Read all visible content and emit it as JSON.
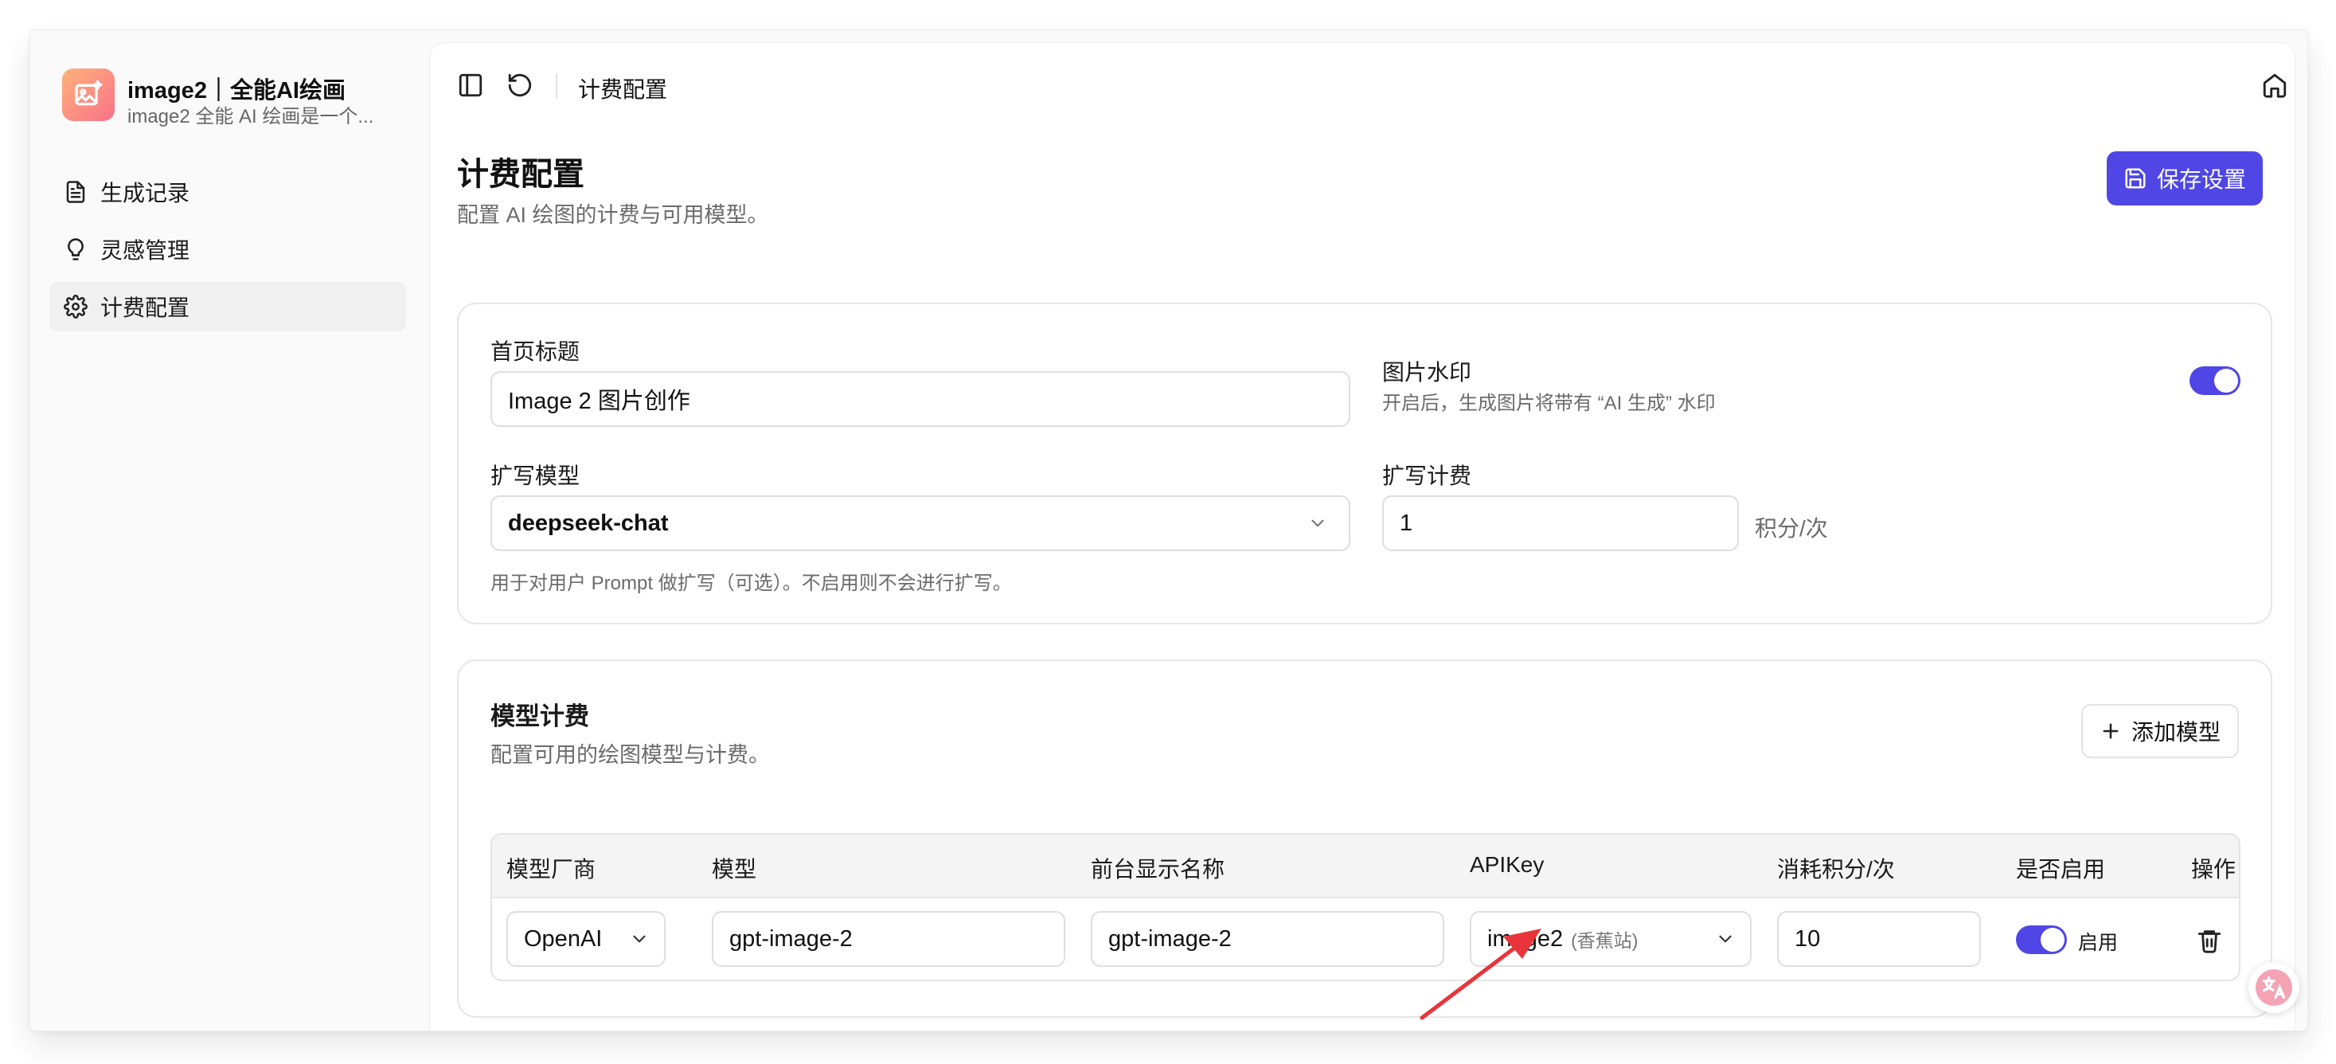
{
  "brand": {
    "title": "image2｜全能AI绘画",
    "subtitle": "image2 全能 AI 绘画是一个..."
  },
  "sidebar": {
    "items": [
      {
        "label": "生成记录",
        "icon": "file-text-icon"
      },
      {
        "label": "灵感管理",
        "icon": "lightbulb-icon"
      },
      {
        "label": "计费配置",
        "icon": "gear-icon",
        "active": true
      }
    ]
  },
  "topbar": {
    "breadcrumb": "计费配置"
  },
  "page": {
    "title": "计费配置",
    "subtitle": "配置 AI 绘图的计费与可用模型。",
    "save_label": "保存设置"
  },
  "settings": {
    "homepage_title_label": "首页标题",
    "homepage_title_value": "Image 2 图片创作",
    "watermark_label": "图片水印",
    "watermark_hint": "开启后，生成图片将带有 “AI 生成” 水印",
    "watermark_enabled": true,
    "expand_model_label": "扩写模型",
    "expand_model_value": "deepseek-chat",
    "expand_model_hint": "用于对用户 Prompt 做扩写（可选）。不启用则不会进行扩写。",
    "expand_cost_label": "扩写计费",
    "expand_cost_value": "1",
    "expand_cost_unit": "积分/次"
  },
  "models": {
    "title": "模型计费",
    "subtitle": "配置可用的绘图模型与计费。",
    "add_label": "添加模型",
    "columns": [
      "模型厂商",
      "模型",
      "前台显示名称",
      "APIKey",
      "消耗积分/次",
      "是否启用",
      "操作"
    ],
    "rows": [
      {
        "vendor": "OpenAI",
        "model": "gpt-image-2",
        "display_name": "gpt-image-2",
        "apikey": "image2",
        "apikey_note": "(香蕉站)",
        "cost": "10",
        "enabled": true,
        "enabled_label": "启用"
      }
    ]
  },
  "colors": {
    "accent": "#4f46e5",
    "annotation_arrow": "#e8343a"
  }
}
